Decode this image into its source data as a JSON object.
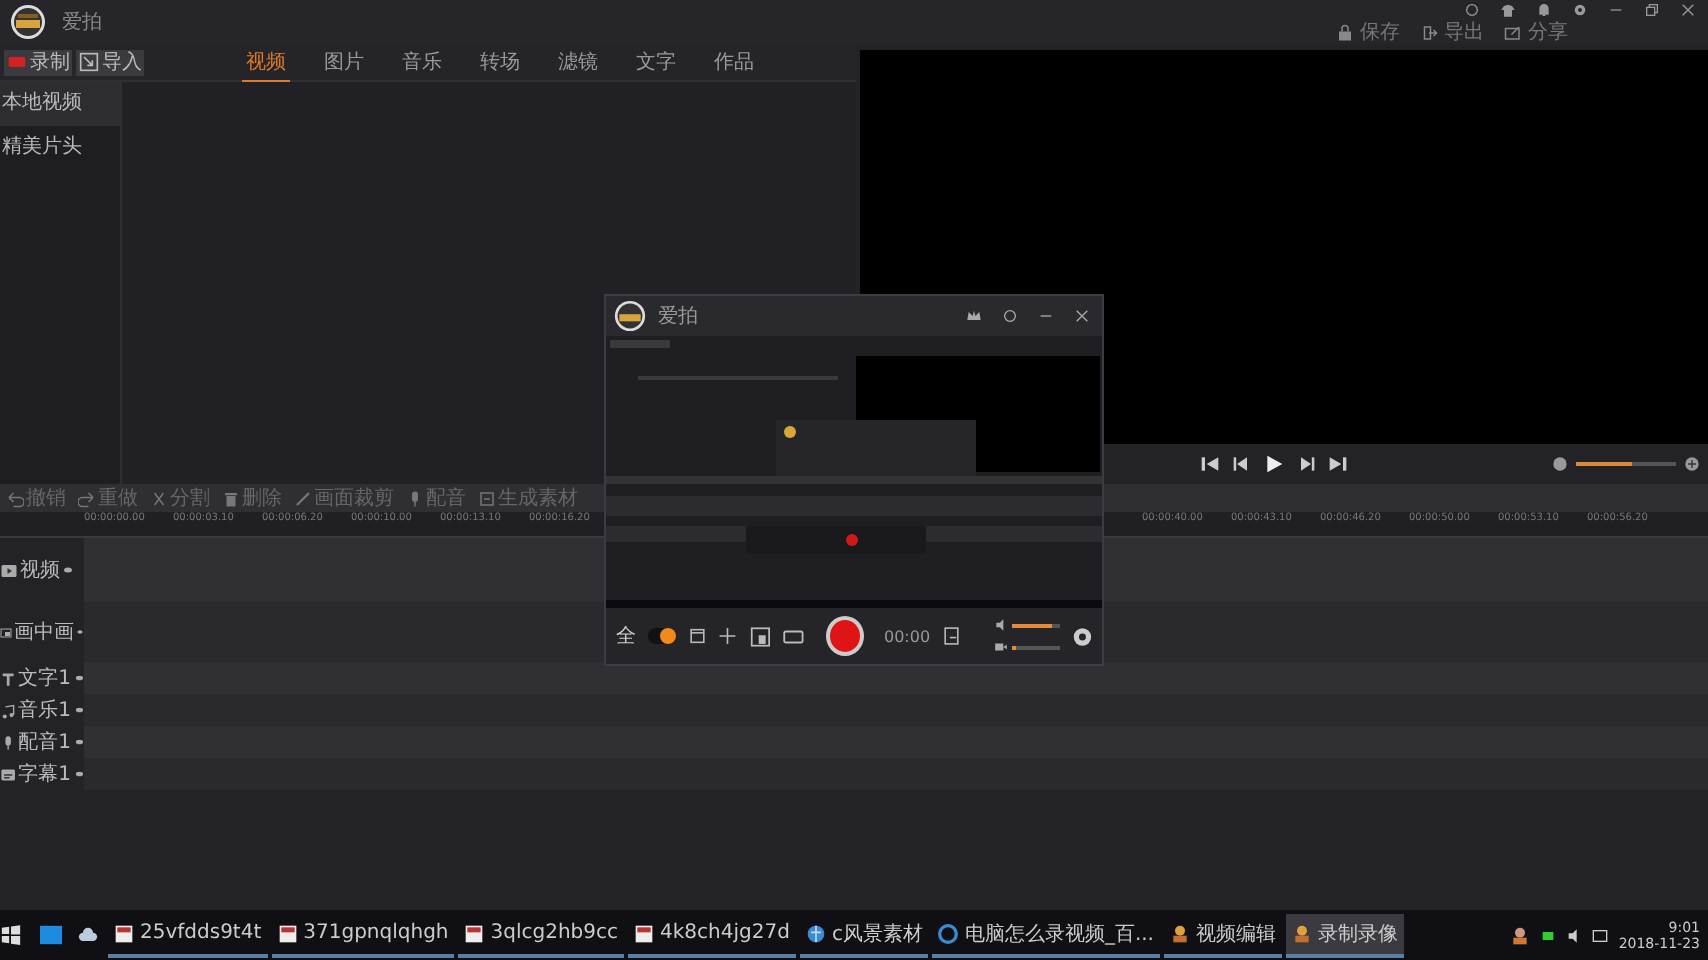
{
  "app": {
    "title": "爱拍"
  },
  "header_actions": [
    {
      "kind": "save",
      "label": "保存"
    },
    {
      "kind": "export",
      "label": "导出"
    },
    {
      "kind": "share",
      "label": "分享"
    }
  ],
  "library": {
    "buttons": [
      {
        "kind": "record",
        "label": "录制"
      },
      {
        "kind": "import",
        "label": "导入"
      }
    ],
    "tabs": [
      {
        "label": "视频",
        "selected": true
      },
      {
        "label": "图片",
        "selected": false
      },
      {
        "label": "音乐",
        "selected": false
      },
      {
        "label": "转场",
        "selected": false
      },
      {
        "label": "滤镜",
        "selected": false
      },
      {
        "label": "文字",
        "selected": false
      },
      {
        "label": "作品",
        "selected": false
      }
    ],
    "sidebar": [
      {
        "label": "本地视频",
        "selected": true
      },
      {
        "label": "精美片头",
        "selected": false
      }
    ]
  },
  "preview": {
    "volume": {
      "level": 0.55
    }
  },
  "toolbar": [
    {
      "kind": "undo",
      "label": "撤销"
    },
    {
      "kind": "redo",
      "label": "重做"
    },
    {
      "kind": "split",
      "label": "分割"
    },
    {
      "kind": "delete",
      "label": "删除"
    },
    {
      "kind": "crop",
      "label": "画面裁剪"
    },
    {
      "kind": "voice",
      "label": "配音"
    },
    {
      "kind": "make",
      "label": "生成素材"
    }
  ],
  "ruler": {
    "left": [
      "00:00:00.00",
      "00:00:03.10",
      "00:00:06.20",
      "00:00:10.00",
      "00:00:13.10",
      "00:00:16.20"
    ],
    "right": [
      "00:00:40.00",
      "00:00:43.10",
      "00:00:46.20",
      "00:00:50.00",
      "00:00:53.10",
      "00:00:56.20"
    ]
  },
  "tracks": [
    {
      "kind": "video",
      "label": "视频"
    },
    {
      "kind": "pip",
      "label": "画中画"
    },
    {
      "kind": "text",
      "label": "文字1"
    },
    {
      "kind": "music",
      "label": "音乐1"
    },
    {
      "kind": "voice",
      "label": "配音1"
    },
    {
      "kind": "subtitle",
      "label": "字幕1"
    }
  ],
  "recorder": {
    "title": "爱拍",
    "mode_label": "全",
    "toggle": {
      "on": true
    },
    "time": "00:00",
    "sliders": [
      {
        "level": 0.85
      },
      {
        "level": 0.1
      }
    ]
  },
  "taskbar": {
    "items": [
      {
        "kind": "doc",
        "label": "25vfdds9t4t",
        "selected": false
      },
      {
        "kind": "doc",
        "label": "371gpnqlqhgh",
        "selected": false
      },
      {
        "kind": "doc",
        "label": "3qlcg2hb9cc",
        "selected": false
      },
      {
        "kind": "doc",
        "label": "4k8ch4jg27d",
        "selected": false
      },
      {
        "kind": "globe",
        "label": "c风景素材",
        "selected": false
      },
      {
        "kind": "browser",
        "label": "电脑怎么录视频_百...",
        "selected": false
      },
      {
        "kind": "app",
        "label": "视频编辑",
        "selected": false
      },
      {
        "kind": "app",
        "label": "录制录像",
        "selected": true
      }
    ],
    "time": "9:01",
    "date": "2018-11-23"
  }
}
